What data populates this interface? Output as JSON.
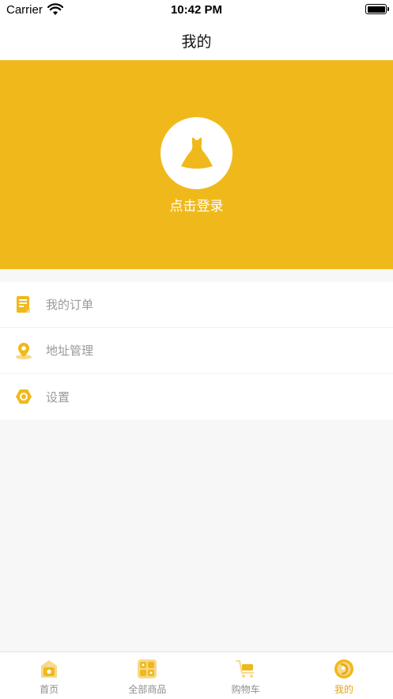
{
  "status_bar": {
    "carrier": "Carrier",
    "time": "10:42 PM"
  },
  "nav": {
    "title": "我的"
  },
  "profile": {
    "login_label": "点击登录"
  },
  "menu": {
    "items": [
      {
        "label": "我的订单",
        "icon": "order-icon"
      },
      {
        "label": "地址管理",
        "icon": "location-icon"
      },
      {
        "label": "设置",
        "icon": "settings-icon"
      }
    ]
  },
  "tabs": [
    {
      "label": "首页",
      "icon": "home-icon",
      "active": false
    },
    {
      "label": "全部商品",
      "icon": "grid-icon",
      "active": false
    },
    {
      "label": "购物车",
      "icon": "cart-icon",
      "active": false
    },
    {
      "label": "我的",
      "icon": "profile-icon",
      "active": true
    }
  ],
  "colors": {
    "accent": "#f0b91b",
    "active_tab": "#e8a416",
    "menu_text": "#9a9a9a"
  }
}
